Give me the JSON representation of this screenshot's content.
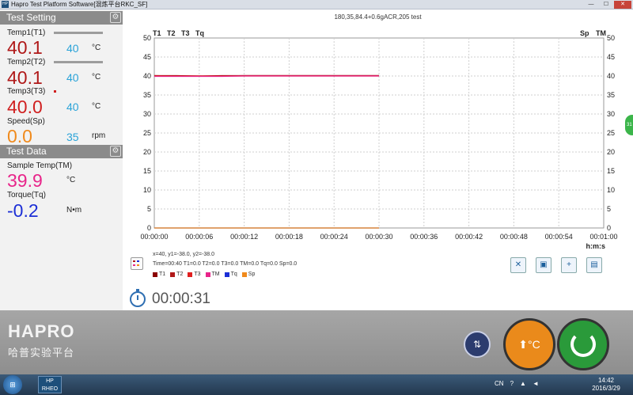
{
  "window": {
    "title": "Hapro Test Platform Software[混炼平台RKC_SF]",
    "logo": "HP",
    "min": "—",
    "max": "☐",
    "close": "✕"
  },
  "test_setting": {
    "header": "Test Setting",
    "t1": {
      "label": "Temp1(T1)",
      "value": "40.1",
      "set": "40",
      "unit": "°C",
      "color": "#b01919"
    },
    "t2": {
      "label": "Temp2(T2)",
      "value": "40.1",
      "set": "40",
      "unit": "°C",
      "color": "#b01919"
    },
    "t3": {
      "label": "Temp3(T3)",
      "value": "40.0",
      "set": "40",
      "unit": "°C",
      "color": "#d02020"
    },
    "sp": {
      "label": "Speed(Sp)",
      "value": "0.0",
      "set": "35",
      "unit": "rpm",
      "color": "#f08a1c"
    }
  },
  "test_data": {
    "header": "Test Data",
    "tm": {
      "label": "Sample Temp(TM)",
      "value": "39.9",
      "unit": "°C",
      "color": "#e8258a"
    },
    "tq": {
      "label": "Torque(Tq)",
      "value": "-0.2",
      "unit": "N•m",
      "color": "#1c2fd6"
    }
  },
  "chart_data": {
    "type": "line",
    "title": "180,35,84.4+0.6gACR,205 test",
    "series_labels_left": [
      "T1",
      "T2",
      "T3",
      "Tq"
    ],
    "series_labels_right": [
      "Sp",
      "TM"
    ],
    "xlabel": "h:m:s",
    "x_ticks": [
      "00:00:00",
      "00:00:06",
      "00:00:12",
      "00:00:18",
      "00:00:24",
      "00:00:30",
      "00:00:36",
      "00:00:42",
      "00:00:48",
      "00:00:54",
      "00:01:00"
    ],
    "y_ticks": [
      "0",
      "5",
      "10",
      "15",
      "20",
      "25",
      "30",
      "35",
      "40",
      "45",
      "50"
    ],
    "xlim": [
      0,
      60
    ],
    "ylim": [
      0,
      50
    ],
    "grid": true,
    "series": [
      {
        "name": "T1",
        "color": "#8b0000",
        "x": [
          0,
          3,
          6,
          9,
          12,
          15,
          18,
          21,
          24,
          27,
          30
        ],
        "values": [
          40.1,
          40.1,
          40.0,
          40.1,
          40.1,
          40.1,
          40.1,
          40.1,
          40.1,
          40.1,
          40.1
        ]
      },
      {
        "name": "T2",
        "color": "#b01919",
        "x": [
          0,
          3,
          6,
          9,
          12,
          15,
          18,
          21,
          24,
          27,
          30
        ],
        "values": [
          40.1,
          40.0,
          40.0,
          40.0,
          40.1,
          40.1,
          40.1,
          40.1,
          40.1,
          40.1,
          40.1
        ]
      },
      {
        "name": "T3",
        "color": "#e02020",
        "x": [
          0,
          3,
          6,
          9,
          12,
          15,
          18,
          21,
          24,
          27,
          30
        ],
        "values": [
          40.0,
          40.0,
          40.0,
          40.0,
          40.0,
          40.0,
          40.0,
          40.0,
          40.0,
          40.0,
          40.0
        ]
      },
      {
        "name": "TM",
        "color": "#e8258a",
        "x": [
          0,
          3,
          6,
          9,
          12,
          15,
          18,
          21,
          24,
          27,
          30
        ],
        "values": [
          39.9,
          39.9,
          39.9,
          39.9,
          40.0,
          40.0,
          40.0,
          40.0,
          40.0,
          40.0,
          40.0
        ]
      },
      {
        "name": "Tq",
        "color": "#1c2fd6",
        "x": [
          0,
          30
        ],
        "values": [
          0,
          0
        ]
      },
      {
        "name": "Sp",
        "color": "#f08a1c",
        "x": [
          0,
          30
        ],
        "values": [
          0,
          0
        ]
      }
    ]
  },
  "cursor_info": {
    "line1": "x=40, y1=-38.0, y2=-38.0",
    "line2": "Time=00:40 T1=0.0 T2=0.0 T3=0.0 TM=0.0 Tq=0.0 Sp=0.0"
  },
  "legend": [
    {
      "name": "T1",
      "color": "#8b0000"
    },
    {
      "name": "T2",
      "color": "#b01919"
    },
    {
      "name": "T3",
      "color": "#e02020"
    },
    {
      "name": "TM",
      "color": "#e8258a"
    },
    {
      "name": "Tq",
      "color": "#1c2fd6"
    },
    {
      "name": "Sp",
      "color": "#f08a1c"
    }
  ],
  "toolbar": {
    "clear_icon": "clear-chart-icon",
    "save_icon": "save-icon",
    "add_icon": "add-chart-icon",
    "open_icon": "open-folder-icon"
  },
  "timer": {
    "elapsed": "00:00:31"
  },
  "brand": {
    "name": "HAPRO",
    "subtitle": "哈普实验平台"
  },
  "buttons": {
    "heat": "°C"
  },
  "side_tab": "31",
  "taskbar": {
    "app": "HP",
    "app_sub": "RHEO",
    "lang": "CN",
    "time": "14:42",
    "date": "2016/3/29"
  }
}
